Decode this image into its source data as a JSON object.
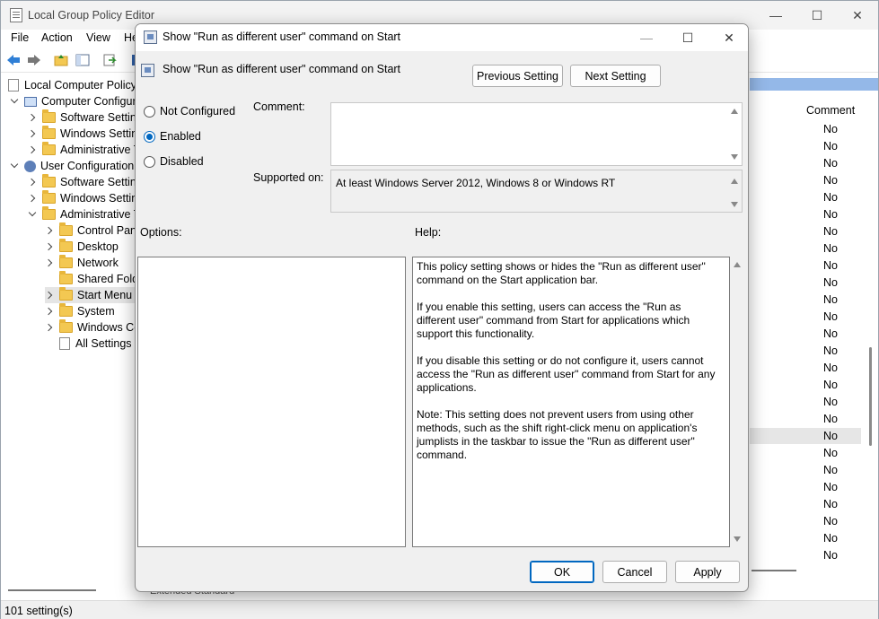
{
  "main": {
    "title": "Local Group Policy Editor",
    "menu": [
      "File",
      "Action",
      "View",
      "He"
    ],
    "tree": [
      {
        "label": "Local Computer Policy",
        "icon": "doc-icon",
        "indent": 0,
        "chevron": "none"
      },
      {
        "label": "Computer Configur",
        "icon": "computer-icon",
        "indent": 1,
        "chevron": "down"
      },
      {
        "label": "Software Setting",
        "icon": "folder-icon",
        "indent": 2,
        "chevron": "right"
      },
      {
        "label": "Windows Setting",
        "icon": "folder-icon",
        "indent": 2,
        "chevron": "right"
      },
      {
        "label": "Administrative T",
        "icon": "folder-icon",
        "indent": 2,
        "chevron": "right"
      },
      {
        "label": "User Configuration",
        "icon": "user-icon",
        "indent": 1,
        "chevron": "down"
      },
      {
        "label": "Software Setting",
        "icon": "folder-icon",
        "indent": 2,
        "chevron": "right"
      },
      {
        "label": "Windows Setting",
        "icon": "folder-icon",
        "indent": 2,
        "chevron": "right"
      },
      {
        "label": "Administrative T",
        "icon": "folder-icon",
        "indent": 2,
        "chevron": "down"
      },
      {
        "label": "Control Pane",
        "icon": "folder-icon",
        "indent": 3,
        "chevron": "right"
      },
      {
        "label": "Desktop",
        "icon": "folder-icon",
        "indent": 3,
        "chevron": "right"
      },
      {
        "label": "Network",
        "icon": "folder-icon",
        "indent": 3,
        "chevron": "right"
      },
      {
        "label": "Shared Folde",
        "icon": "folder-icon",
        "indent": 3,
        "chevron": "none"
      },
      {
        "label": "Start Menu a",
        "icon": "folder-icon",
        "indent": 3,
        "chevron": "right",
        "selected": true
      },
      {
        "label": "System",
        "icon": "folder-icon",
        "indent": 3,
        "chevron": "right"
      },
      {
        "label": "Windows Co",
        "icon": "folder-icon",
        "indent": 3,
        "chevron": "right"
      },
      {
        "label": "All Settings",
        "icon": "settings-icon",
        "indent": 3,
        "chevron": "none"
      }
    ],
    "comment_header": "Comment",
    "comment_values": [
      "No",
      "No",
      "No",
      "No",
      "No",
      "No",
      "No",
      "No",
      "No",
      "No",
      "No",
      "No",
      "No",
      "No",
      "No",
      "No",
      "No",
      "No",
      "No",
      "No",
      "No",
      "No",
      "No",
      "No",
      "No",
      "No"
    ],
    "tabs": [
      "Extended",
      "Standard"
    ],
    "status": "101 setting(s)"
  },
  "dialog": {
    "title": "Show \"Run as different user\" command on Start",
    "setting_name": "Show \"Run as different user\" command on Start",
    "previous_button": "Previous Setting",
    "next_button": "Next Setting",
    "options": {
      "not_configured": "Not Configured",
      "enabled": "Enabled",
      "disabled": "Disabled",
      "selected": "enabled"
    },
    "comment_label": "Comment:",
    "comment_value": "",
    "supported_label": "Supported on:",
    "supported_value": "At least Windows Server 2012, Windows 8 or Windows RT",
    "options_label": "Options:",
    "help_label": "Help:",
    "help_text": "This policy setting shows or hides the \"Run as different user\" command on the Start application bar.\n\nIf you enable this setting, users can access the \"Run as different user\" command from Start for applications which support this functionality.\n\nIf you disable this setting or do not configure it, users cannot access the \"Run as different user\" command from Start for any applications.\n\nNote: This setting does not prevent users from using other methods, such as the shift right-click menu on application's jumplists in the taskbar to issue the \"Run as different user\" command.",
    "ok_button": "OK",
    "cancel_button": "Cancel",
    "apply_button": "Apply"
  }
}
